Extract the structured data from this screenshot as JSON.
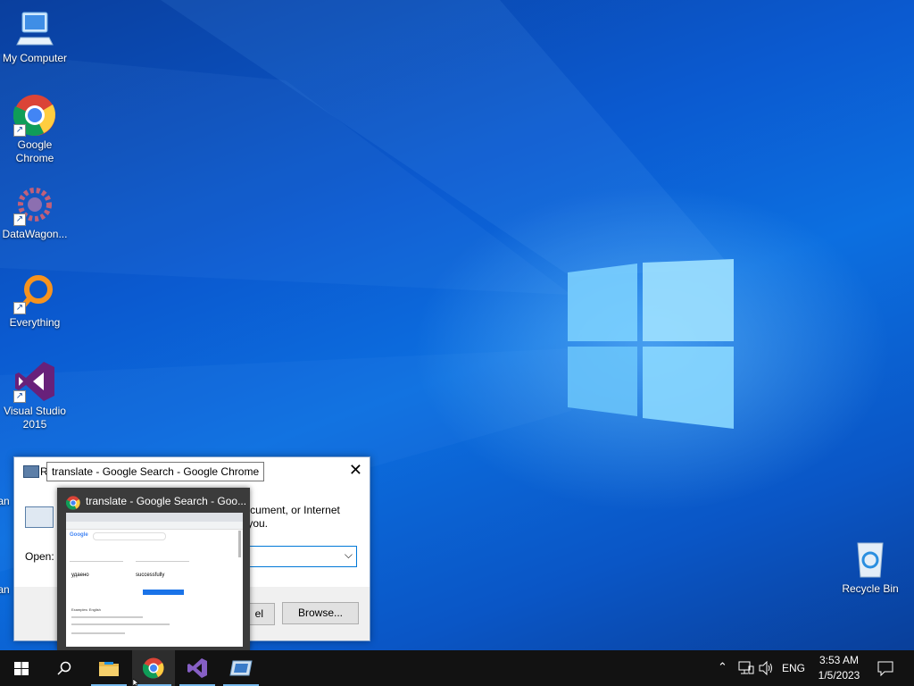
{
  "desktop": {
    "icons": [
      {
        "label": "My Computer",
        "icon": "computer-icon"
      },
      {
        "label": "Google Chrome",
        "icon": "chrome-icon"
      },
      {
        "label": "DataWagon...",
        "icon": "datawagon-icon"
      },
      {
        "label": "Everything",
        "icon": "everything-search-icon"
      },
      {
        "label": "Visual Studio 2015",
        "icon": "visual-studio-icon"
      },
      {
        "label": "Recycle Bin",
        "icon": "recycle-bin-icon"
      }
    ],
    "partial_labels": [
      "an",
      "an"
    ]
  },
  "run_dialog": {
    "title_fragment": "R",
    "description": "Type the name of a program, folder, document, or Internet resource, and Windows will open it for you.",
    "description_visible": "ype the name of a program, folder, document, or Internet",
    "description_visible_2": "r you.",
    "open_label": "Open:",
    "open_value": "",
    "ok_fragment": "el",
    "browse_label": "Browse..."
  },
  "tooltip": {
    "text": "translate - Google Search - Google Chrome"
  },
  "thumbnail": {
    "title": "translate - Google Search - Goo...",
    "preview": {
      "source_text": "удаено",
      "target_text": "successfully",
      "section": "Examples: English"
    }
  },
  "taskbar": {
    "apps": [
      "start",
      "search",
      "file-explorer",
      "chrome",
      "visual-studio",
      "run"
    ],
    "language": "ENG",
    "time": "3:53 AM",
    "date": "1/5/2023"
  },
  "colors": {
    "desktop": "#0a5fcf",
    "taskbar": "#121212",
    "accent": "#76b9ed"
  }
}
